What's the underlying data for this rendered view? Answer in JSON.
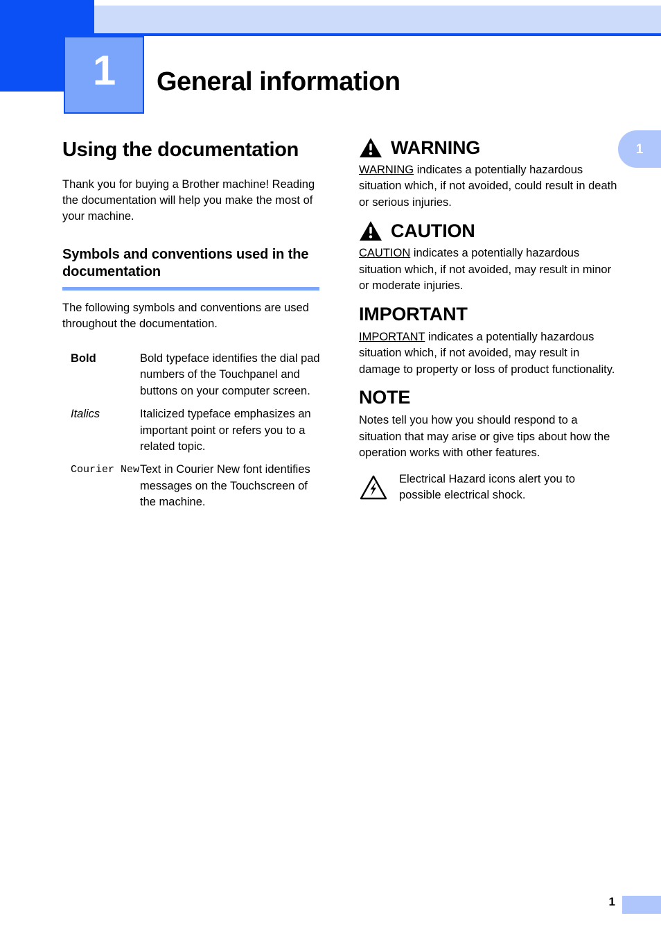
{
  "header": {
    "chapter_number": "1",
    "chapter_title": "General information",
    "tab_number": "1"
  },
  "footer": {
    "page_number": "1"
  },
  "left_column": {
    "section_heading": "Using the documentation",
    "intro_paragraph": "Thank you for buying a Brother machine! Reading the documentation will help you make the most of your machine.",
    "subsection_heading": "Symbols and conventions used in the documentation",
    "subsection_paragraph": "The following symbols and conventions are used throughout the documentation.",
    "conventions": [
      {
        "term": "Bold",
        "style": "bold",
        "description": "Bold typeface identifies the dial pad numbers of the Touchpanel and buttons on your computer screen."
      },
      {
        "term": "Italics",
        "style": "italic",
        "description": "Italicized typeface emphasizes an important point or refers you to a related topic."
      },
      {
        "term": "Courier New",
        "style": "monospace",
        "description": "Text in Courier New font identifies messages on the Touchscreen of the machine."
      }
    ]
  },
  "right_column": {
    "alerts": [
      {
        "label": "WARNING",
        "icon": "warning-triangle-icon",
        "underlined_term": "WARNING",
        "body_rest": " indicates a potentially hazardous situation which, if not avoided, could result in death or serious injuries."
      },
      {
        "label": "CAUTION",
        "icon": "warning-triangle-icon",
        "underlined_term": "CAUTION",
        "body_rest": " indicates a potentially hazardous situation which, if not avoided, may result in minor or moderate injuries."
      },
      {
        "label": "IMPORTANT",
        "icon": "none",
        "underlined_term": "IMPORTANT",
        "body_rest": " indicates a potentially hazardous situation which, if not avoided, may result in damage to property or loss of product functionality."
      },
      {
        "label": "NOTE",
        "icon": "none",
        "underlined_term": "",
        "body_rest": "Notes tell you how you should respond to a situation that may arise or give tips about how the operation works with other features."
      }
    ],
    "hazard_note": {
      "icon": "electrical-hazard-icon",
      "text": "Electrical Hazard icons alert you to possible electrical shock."
    }
  },
  "colors": {
    "deep_blue": "#0a50f5",
    "mid_blue": "#7ba4fb",
    "pale_blue": "#ccdbfa",
    "tab_blue": "#aec6fb"
  }
}
